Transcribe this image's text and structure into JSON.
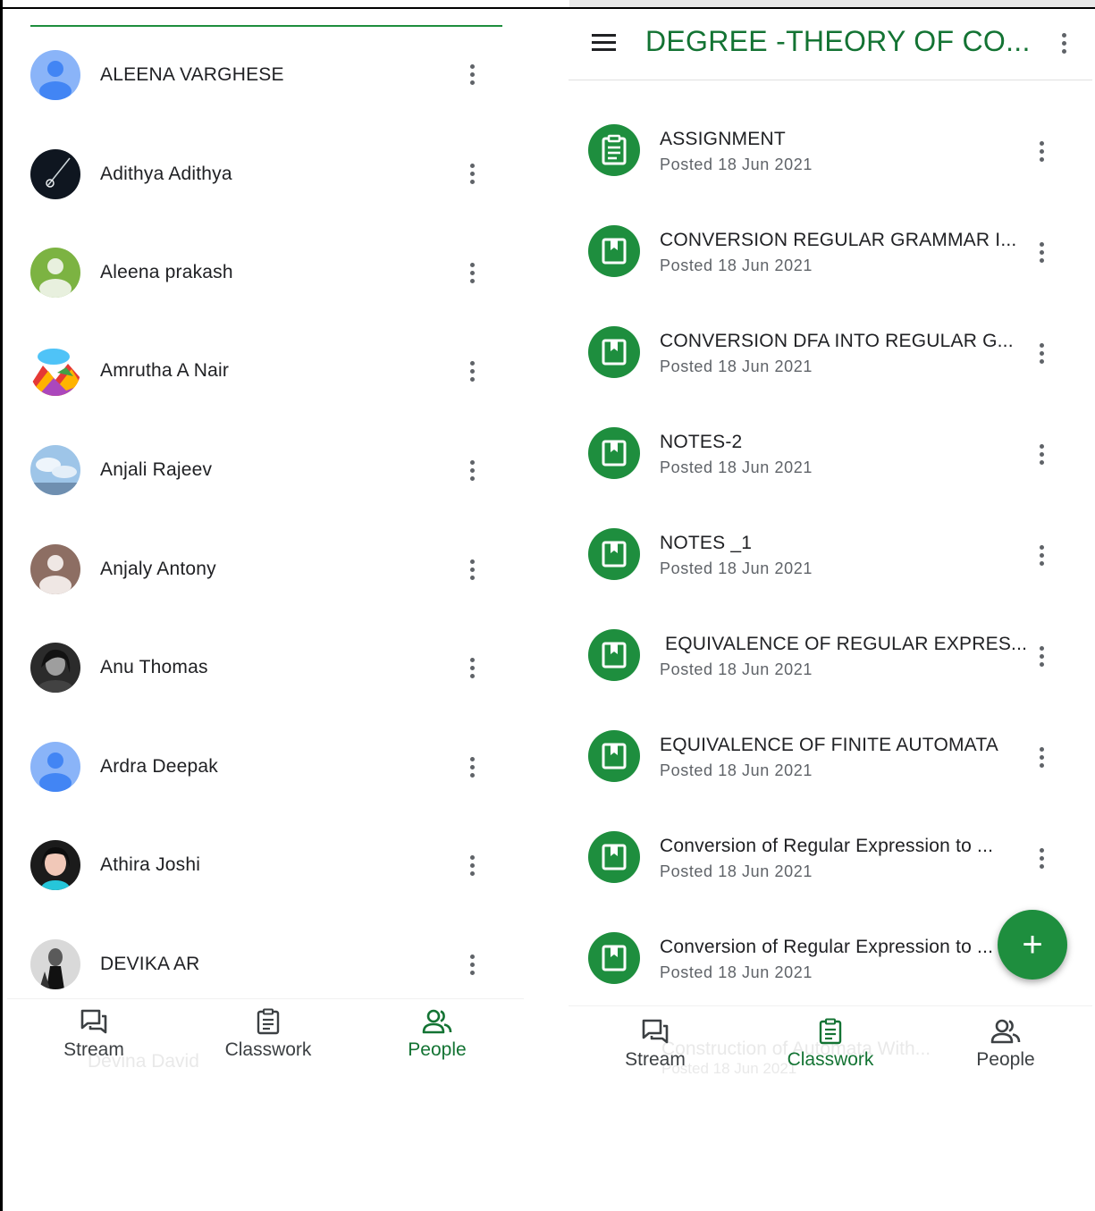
{
  "people_screen": {
    "members": [
      {
        "name": "ALEENA VARGHESE",
        "avatar": "default-blue"
      },
      {
        "name": "Adithya Adithya",
        "avatar": "photo-dark"
      },
      {
        "name": "Aleena prakash",
        "avatar": "default-green"
      },
      {
        "name": "Amrutha A Nair",
        "avatar": "photo-colorful"
      },
      {
        "name": "Anjali Rajeev",
        "avatar": "photo-sky"
      },
      {
        "name": "Anjaly Antony",
        "avatar": "default-brown"
      },
      {
        "name": "Anu Thomas",
        "avatar": "photo-bw"
      },
      {
        "name": "Ardra Deepak",
        "avatar": "default-blue"
      },
      {
        "name": "Athira Joshi",
        "avatar": "photo-portrait"
      },
      {
        "name": "DEVIKA AR",
        "avatar": "photo-bw"
      }
    ],
    "ghost_text": "Devina David",
    "nav": [
      {
        "label": "Stream",
        "icon": "stream-icon",
        "active": false
      },
      {
        "label": "Classwork",
        "icon": "classwork-icon",
        "active": false
      },
      {
        "label": "People",
        "icon": "people-icon",
        "active": true
      }
    ]
  },
  "classwork_screen": {
    "title": "DEGREE -THEORY OF CO...",
    "items": [
      {
        "title": "ASSIGNMENT",
        "posted": "Posted 18 Jun 2021",
        "icon": "assignment-icon"
      },
      {
        "title": "CONVERSION REGULAR GRAMMAR I...",
        "posted": "Posted 18 Jun 2021",
        "icon": "material-icon"
      },
      {
        "title": "CONVERSION DFA INTO REGULAR G...",
        "posted": "Posted 18 Jun 2021",
        "icon": "material-icon"
      },
      {
        "title": "NOTES-2",
        "posted": "Posted 18 Jun 2021",
        "icon": "material-icon"
      },
      {
        "title": "NOTES _1",
        "posted": "Posted 18 Jun 2021",
        "icon": "material-icon"
      },
      {
        "title": " EQUIVALENCE OF REGULAR EXPRES...",
        "posted": "Posted 18 Jun 2021",
        "icon": "material-icon"
      },
      {
        "title": "EQUIVALENCE OF FINITE AUTOMATA",
        "posted": "Posted 18 Jun 2021",
        "icon": "material-icon"
      },
      {
        "title": "Conversion of Regular Expression to ...",
        "posted": "Posted 18 Jun 2021",
        "icon": "material-icon"
      },
      {
        "title": "Conversion of Regular Expression to ...",
        "posted": "Posted 18 Jun 2021",
        "icon": "material-icon"
      }
    ],
    "ghost_text": "Construction of Automata With...",
    "ghost_sub": "Posted 18 Jun 2021",
    "fab_label": "+",
    "nav": [
      {
        "label": "Stream",
        "icon": "stream-icon",
        "active": false
      },
      {
        "label": "Classwork",
        "icon": "classwork-icon",
        "active": true
      },
      {
        "label": "People",
        "icon": "people-icon",
        "active": false
      }
    ]
  },
  "colors": {
    "accent_green": "#137333",
    "icon_green": "#1e8e3e",
    "text_dark": "#202124",
    "text_muted": "#5f6368"
  }
}
